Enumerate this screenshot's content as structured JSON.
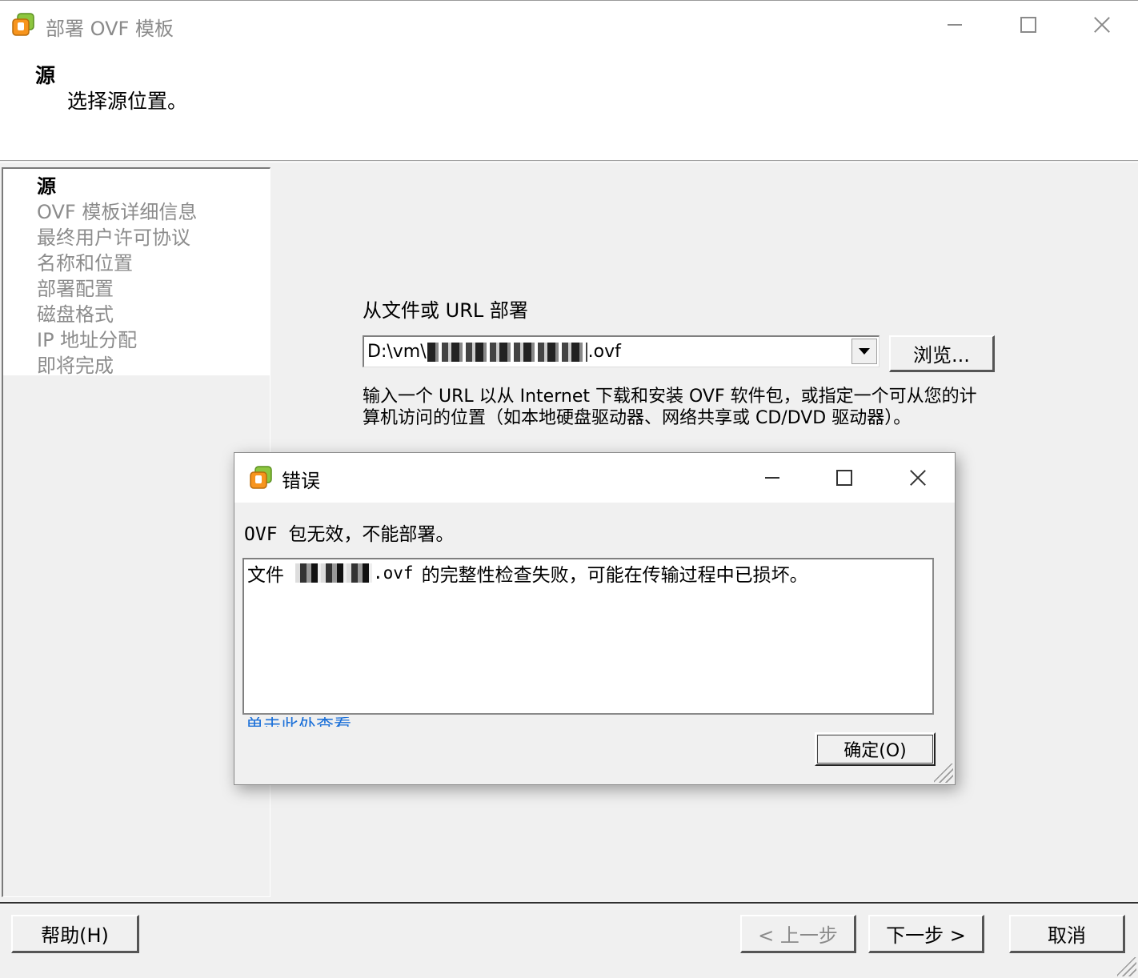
{
  "window": {
    "title": "部署 OVF 模板",
    "icon": "vsphere-logo-icon"
  },
  "header": {
    "title": "源",
    "subtitle": "选择源位置。"
  },
  "steps": [
    {
      "label": "源",
      "active": true
    },
    {
      "label": "OVF 模板详细信息",
      "active": false
    },
    {
      "label": "最终用户许可协议",
      "active": false
    },
    {
      "label": "名称和位置",
      "active": false
    },
    {
      "label": "部署配置",
      "active": false
    },
    {
      "label": "磁盘格式",
      "active": false
    },
    {
      "label": "IP 地址分配",
      "active": false
    },
    {
      "label": "即将完成",
      "active": false
    }
  ],
  "source": {
    "label": "从文件或 URL 部署",
    "value_prefix": "D:\\vm\\",
    "value_suffix": ".ovf",
    "browse_label": "浏览...",
    "hint": "输入一个 URL 以从 Internet 下载和安装 OVF 软件包，或指定一个可从您的计算机访问的位置（如本地硬盘驱动器、网络共享或 CD/DVD 驱动器）。"
  },
  "buttons": {
    "help": "帮助(H)",
    "back": "< 上一步",
    "next": "下一步 >",
    "cancel": "取消"
  },
  "error_dialog": {
    "title": "错误",
    "message": "OVF 包无效，不能部署。",
    "detail_prefix": "文件",
    "detail_ext": ".ovf",
    "detail_suffix": "的完整性检查失败，可能在传输过程中已损坏。",
    "ok_label": "确定(O)"
  },
  "colors": {
    "dialog_bg": "#f0f0f0",
    "link": "#1a6fd8",
    "disabled_text": "#8c8c8c"
  }
}
